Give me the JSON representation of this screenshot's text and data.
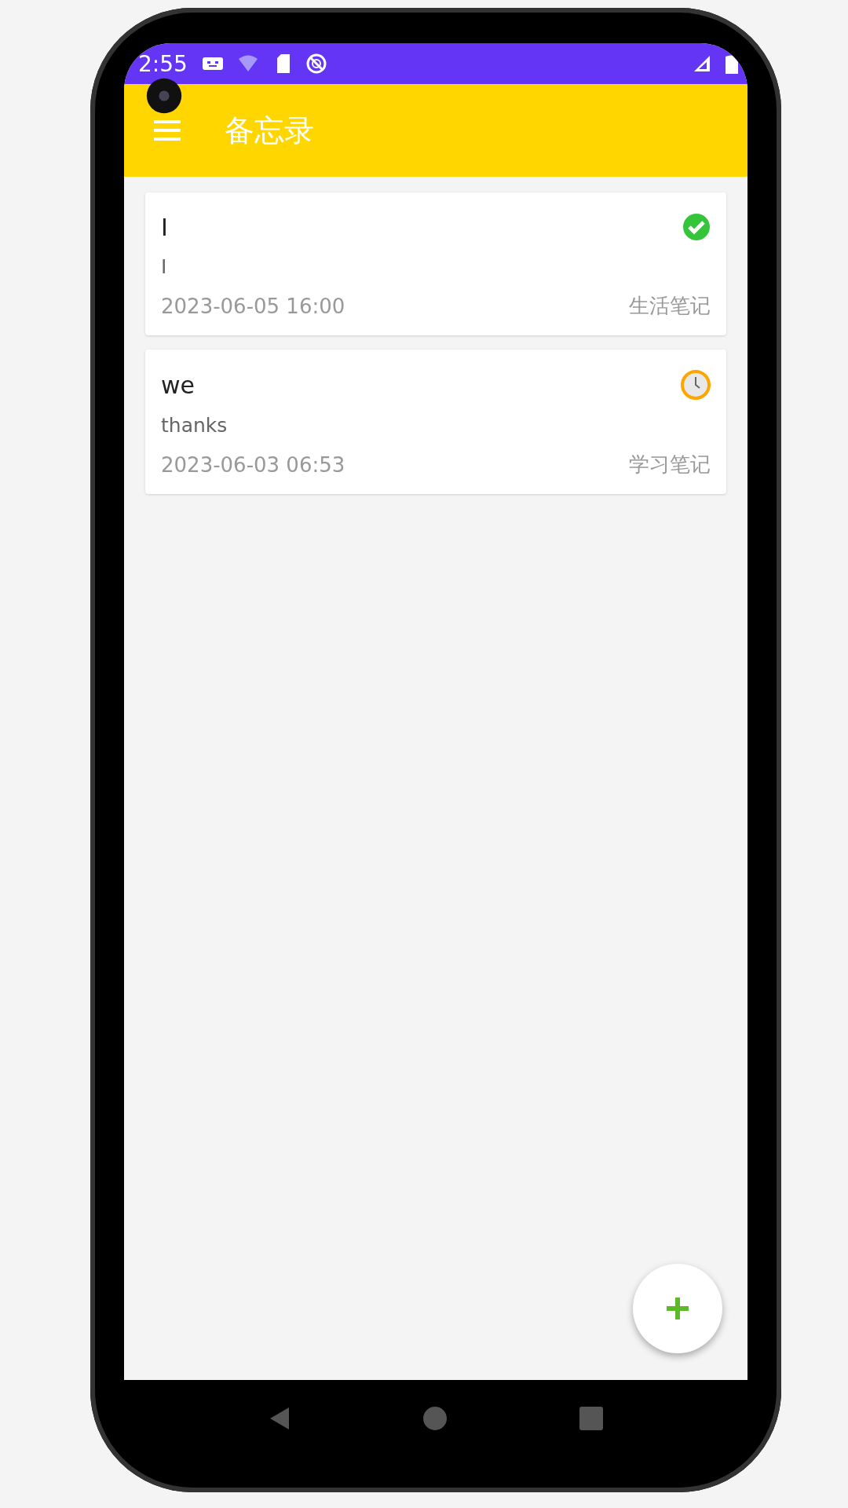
{
  "status_bar": {
    "time": "2:55"
  },
  "app_bar": {
    "title": "备忘录"
  },
  "notes": [
    {
      "title": "I",
      "body": "I",
      "date": "2023-06-05 16:00",
      "category": "生活笔记",
      "completed": true
    },
    {
      "title": "we",
      "body": "thanks",
      "date": "2023-06-03 06:53",
      "category": "学习笔记",
      "completed": false
    }
  ]
}
